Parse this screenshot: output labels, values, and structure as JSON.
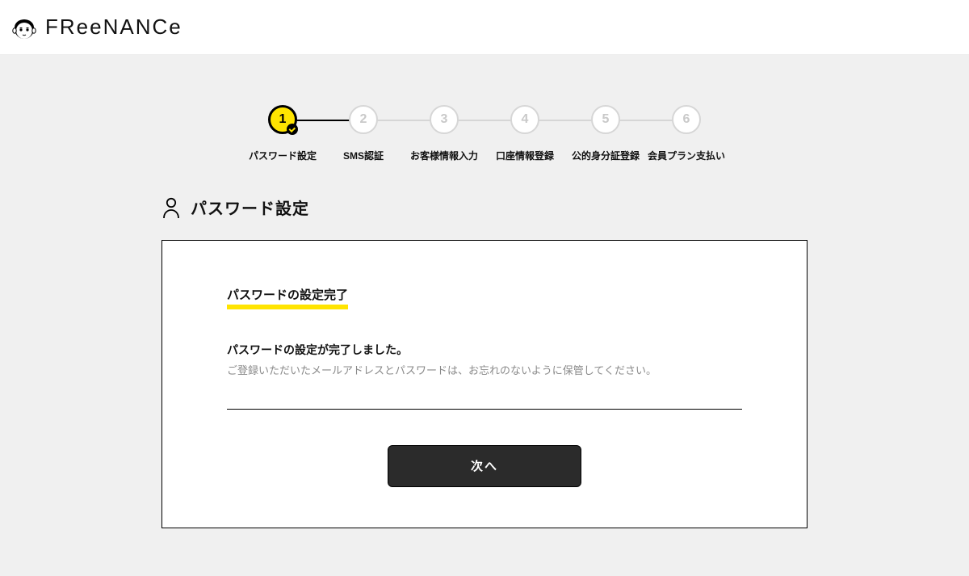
{
  "header": {
    "brand": "FReeNANCe"
  },
  "stepper": {
    "active_index": 0,
    "steps": [
      {
        "num": "1",
        "label": "パスワード設定"
      },
      {
        "num": "2",
        "label": "SMS認証"
      },
      {
        "num": "3",
        "label": "お客様情報入力"
      },
      {
        "num": "4",
        "label": "口座情報登録"
      },
      {
        "num": "5",
        "label": "公的身分証登録"
      },
      {
        "num": "6",
        "label": "会員プラン支払い"
      }
    ]
  },
  "section": {
    "title": "パスワード設定"
  },
  "panel": {
    "complete_title": "パスワードの設定完了",
    "message_bold": "パスワードの設定が完了しました。",
    "message_note": "ご登録いただいたメールアドレスとパスワードは、お忘れのないように保管してください。",
    "next_label": "次へ"
  }
}
